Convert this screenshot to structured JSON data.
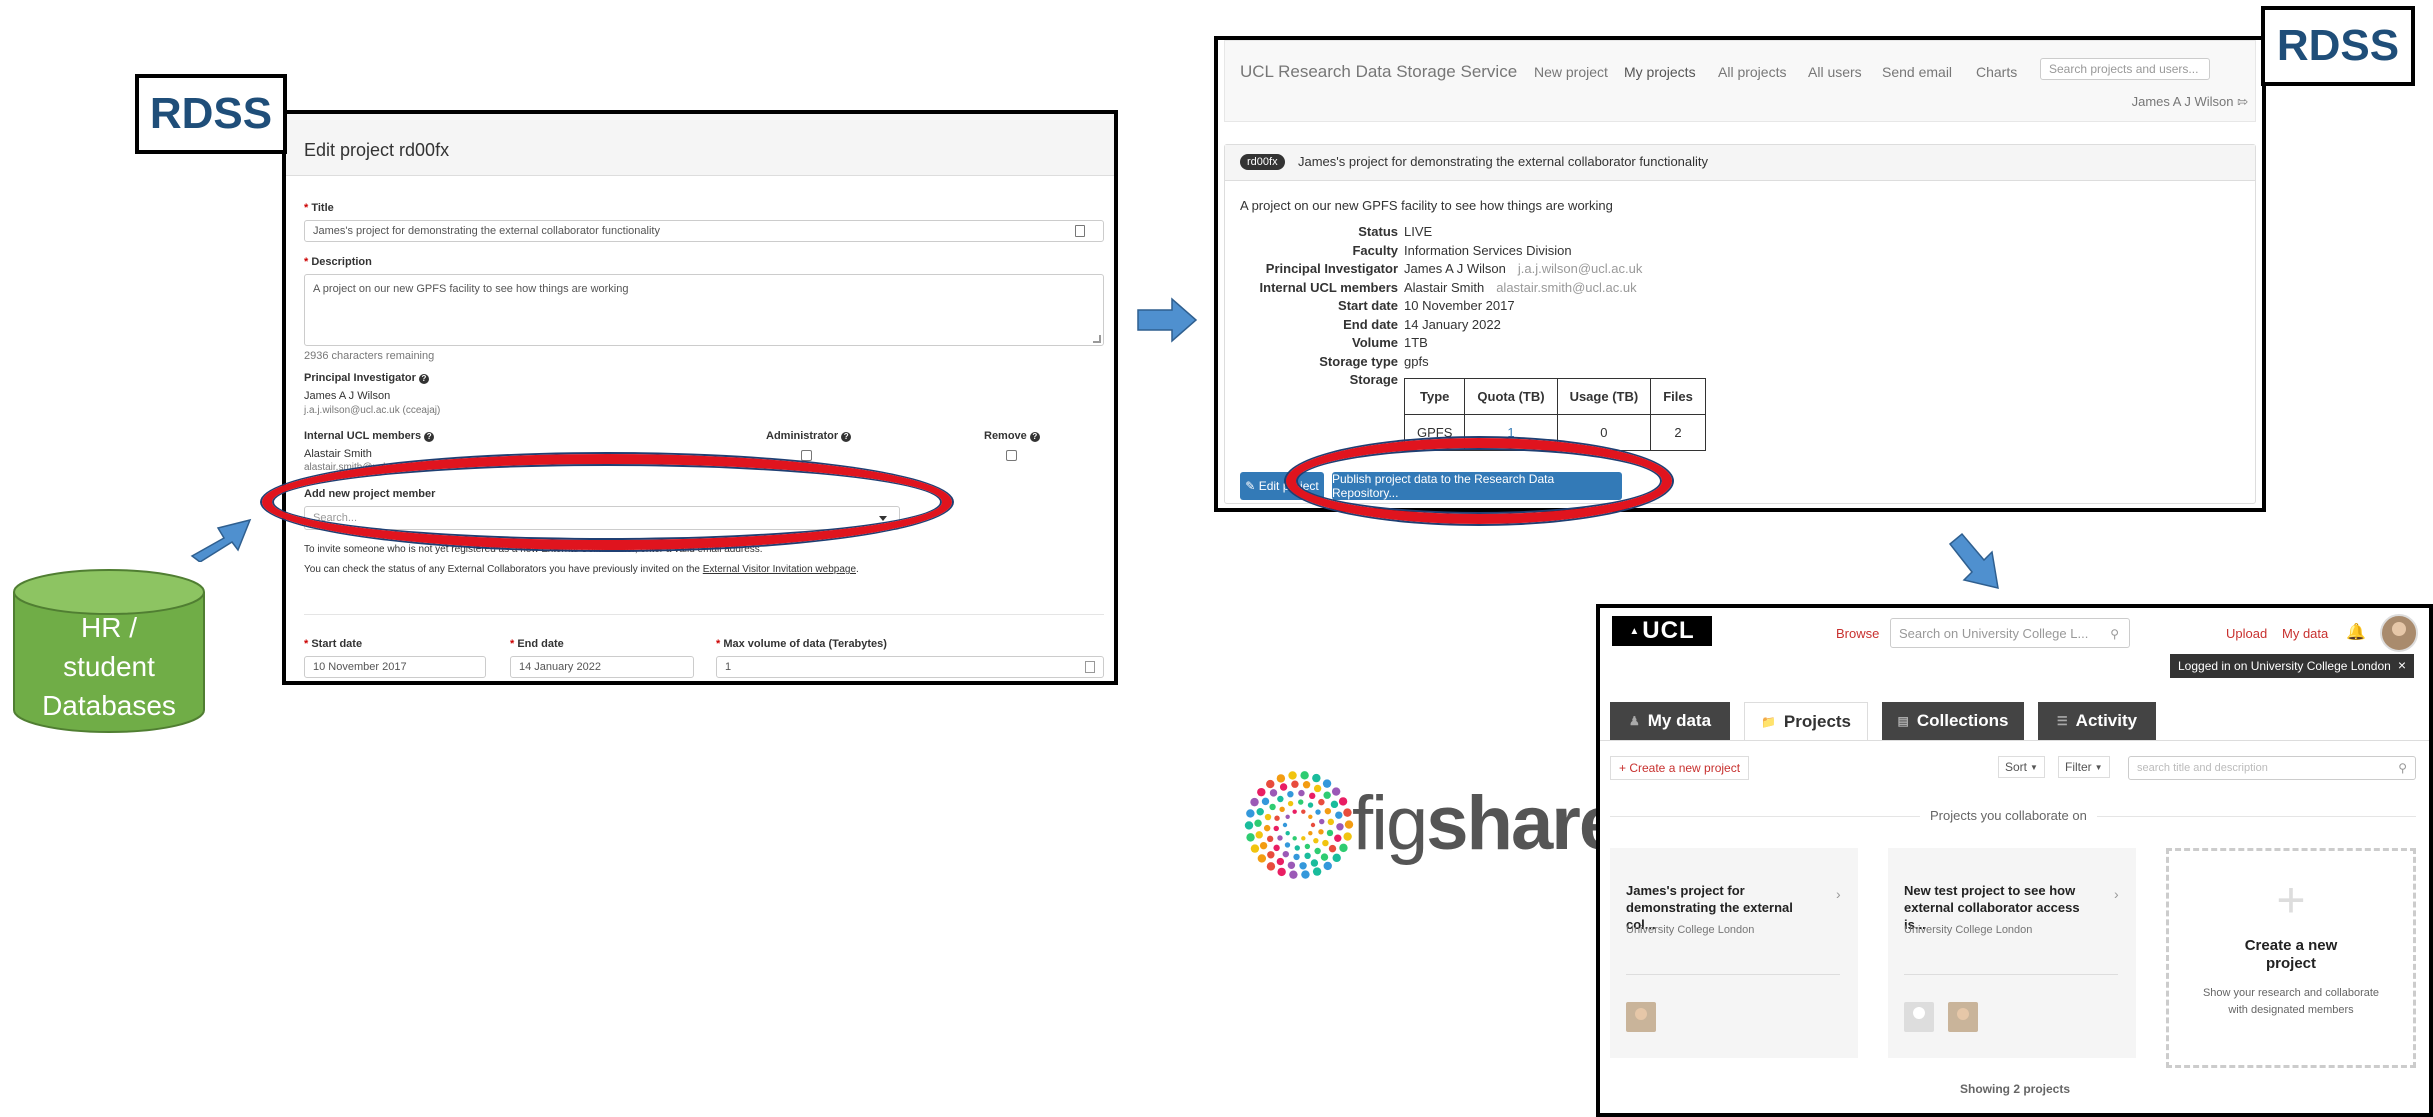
{
  "rdss_label": "RDSS",
  "hr_db": {
    "line1": "HR /",
    "line2": "student",
    "line3": "Databases"
  },
  "edit_panel": {
    "heading": "Edit project rd00fx",
    "title_label": "Title",
    "title_value": "James's project for demonstrating the external collaborator functionality",
    "description_label": "Description",
    "description_value": "A project on our new GPFS facility to see how things are working",
    "chars_remaining": "2936 characters remaining",
    "pi_label": "Principal Investigator",
    "pi_name": "James A J Wilson",
    "pi_email": "j.a.j.wilson@ucl.ac.uk (cceajaj)",
    "members_label": "Internal UCL members",
    "admin_label": "Administrator",
    "remove_label": "Remove",
    "member_name": "Alastair Smith",
    "member_email": "alastair.smith@ucl.ac.uk",
    "add_member_label": "Add new project member",
    "search_placeholder": "Search...",
    "invite_text": "To invite someone who is not yet registered as a new External Collaborator, enter a valid email address.",
    "status_text_pre": "You can check the status of any External Collaborators you have previously invited on the ",
    "status_link": "External Visitor Invitation webpage",
    "status_text_post": ".",
    "start_label": "Start date",
    "start_value": "10 November 2017",
    "end_label": "End date",
    "end_value": "14 January 2022",
    "volume_label": "Max volume of data (Terabytes)",
    "volume_value": "1"
  },
  "view_panel": {
    "brand": "UCL Research Data Storage Service",
    "nav": [
      "New project",
      "My projects",
      "All projects",
      "All users",
      "Send email",
      "Charts"
    ],
    "search_placeholder": "Search projects and users...",
    "user": "James A J Wilson",
    "project_badge": "rd00fx",
    "project_title": "James's project for demonstrating the external collaborator functionality",
    "description": "A project on our new GPFS facility to see how things are working",
    "details": [
      {
        "k": "Status",
        "v": "LIVE",
        "e": ""
      },
      {
        "k": "Faculty",
        "v": "Information Services Division",
        "e": ""
      },
      {
        "k": "Principal Investigator",
        "v": "James A J Wilson",
        "e": "j.a.j.wilson@ucl.ac.uk"
      },
      {
        "k": "Internal UCL members",
        "v": "Alastair Smith",
        "e": "alastair.smith@ucl.ac.uk"
      },
      {
        "k": "Start date",
        "v": "10 November 2017",
        "e": ""
      },
      {
        "k": "End date",
        "v": "14 January 2022",
        "e": ""
      },
      {
        "k": "Volume",
        "v": "1TB",
        "e": ""
      },
      {
        "k": "Storage type",
        "v": "gpfs",
        "e": ""
      },
      {
        "k": "Storage",
        "v": "",
        "e": ""
      }
    ],
    "storage_headers": [
      "Type",
      "Quota (TB)",
      "Usage (TB)",
      "Files"
    ],
    "storage_row": [
      "GPFS",
      "1",
      "0",
      "2"
    ],
    "edit_button": "Edit project",
    "publish_button": "Publish project data to the Research Data Repository..."
  },
  "figshare_logo": {
    "part1": "fig",
    "part2": "share"
  },
  "figshare_panel": {
    "ucl_logo": "UCL",
    "browse": "Browse",
    "search_placeholder": "Search on University College L...",
    "upload": "Upload",
    "my_data": "My data",
    "login_tooltip": "Logged in on University College London",
    "tabs": [
      "My data",
      "Projects",
      "Collections",
      "Activity"
    ],
    "create_project_link": "+ Create a new project",
    "sort": "Sort",
    "filter": "Filter",
    "filter_placeholder": "search title and description",
    "section_title": "Projects you collaborate on",
    "cards": [
      {
        "title": "James's project for demonstrating the external col...",
        "org": "University College London"
      },
      {
        "title": "New test project to see how external collaborator access is...",
        "org": "University College London"
      }
    ],
    "new_card_title": "Create a new project",
    "new_card_desc": "Show your research and collaborate with designated members",
    "footer": "Showing 2 projects"
  },
  "colors": {
    "rdss_blue": "#1f4e79",
    "arrow_blue": "#4f90cf",
    "db_green": "#70ad47",
    "highlight_red": "#e0141e",
    "btn_blue": "#337ab7",
    "fig_red": "#c8312f"
  }
}
